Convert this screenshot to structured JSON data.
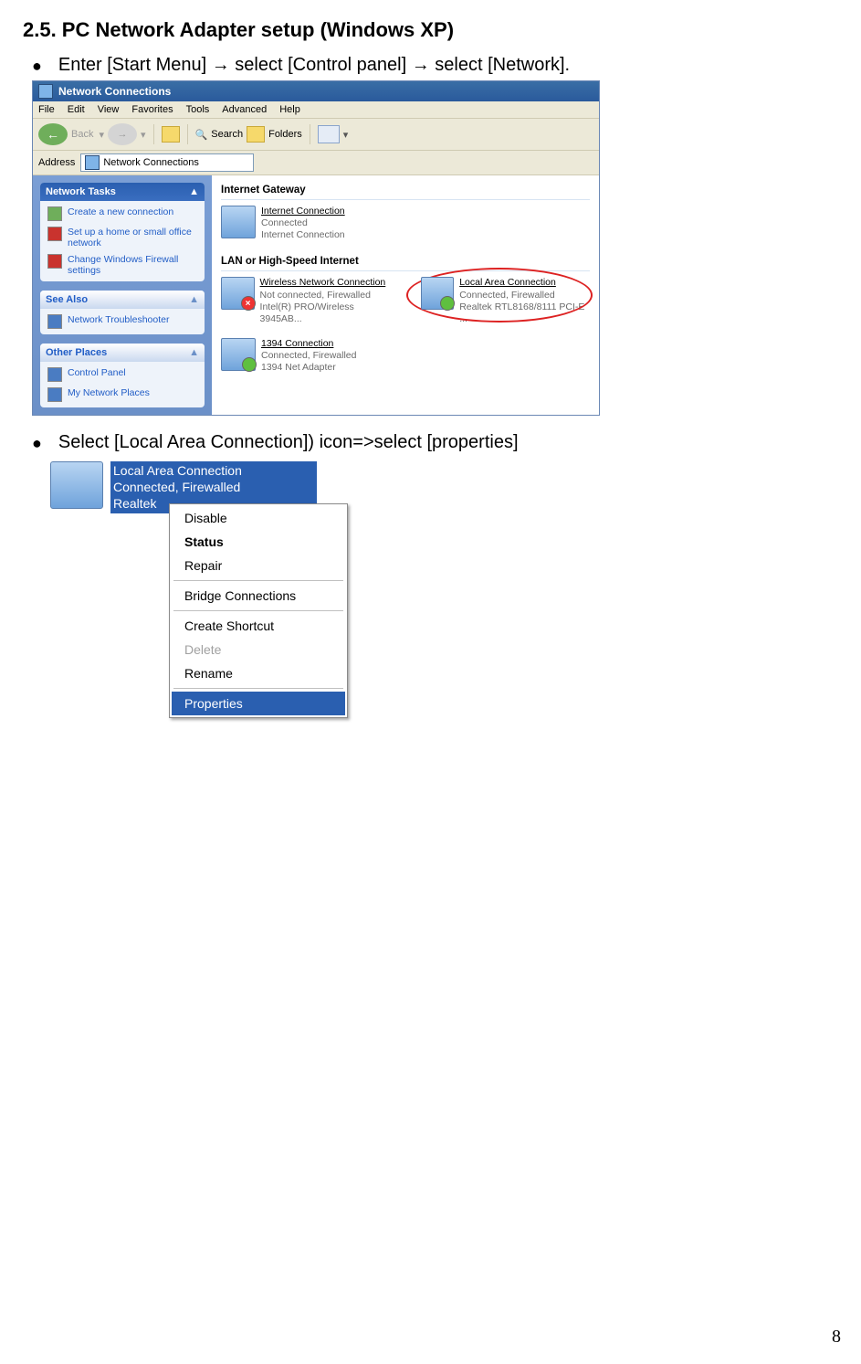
{
  "section_title": "2.5. PC Network Adapter setup (Windows XP)",
  "bullets": {
    "b1": "Enter [Start Menu] → select [Control panel] → select [Network].",
    "b2": "Select [Local Area Connection]) icon=>select [properties]"
  },
  "page_number": "8",
  "win1": {
    "title": "Network Connections",
    "menus": [
      "File",
      "Edit",
      "View",
      "Favorites",
      "Tools",
      "Advanced",
      "Help"
    ],
    "toolbar": {
      "back": "Back",
      "search": "Search",
      "folders": "Folders"
    },
    "address_label": "Address",
    "address_value": "Network Connections",
    "left": {
      "tasks_hd": "Network Tasks",
      "tasks": [
        "Create a new connection",
        "Set up a home or small office network",
        "Change Windows Firewall settings"
      ],
      "seealso_hd": "See Also",
      "seealso": [
        "Network Troubleshooter"
      ],
      "other_hd": "Other Places",
      "other": [
        "Control Panel",
        "My Network Places"
      ]
    },
    "groups": {
      "gateway_hd": "Internet Gateway",
      "gateway": {
        "name": "Internet Connection",
        "status": "Connected",
        "dev": "Internet Connection"
      },
      "lan_hd": "LAN or High-Speed Internet",
      "wireless": {
        "name": "Wireless Network Connection",
        "status": "Not connected, Firewalled",
        "dev": "Intel(R) PRO/Wireless 3945AB..."
      },
      "lac": {
        "name": "Local Area Connection",
        "status": "Connected, Firewalled",
        "dev": "Realtek RTL8168/8111 PCI-E ..."
      },
      "ieee": {
        "name": "1394 Connection",
        "status": "Connected, Firewalled",
        "dev": "1394 Net Adapter"
      }
    }
  },
  "shot2": {
    "label_line1": "Local Area Connection",
    "label_line2": "Connected, Firewalled",
    "label_line3": "Realtek",
    "menu": {
      "disable": "Disable",
      "status": "Status",
      "repair": "Repair",
      "bridge": "Bridge Connections",
      "shortcut": "Create Shortcut",
      "delete": "Delete",
      "rename": "Rename",
      "properties": "Properties"
    }
  }
}
